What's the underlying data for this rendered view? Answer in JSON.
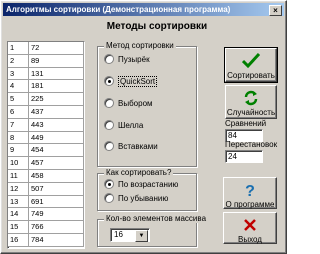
{
  "window": {
    "title": "Алгоритмы сортировки (Демонстрационная программа)",
    "close_glyph": "×"
  },
  "heading": "Методы сортировки",
  "list": {
    "rows": [
      {
        "index": "1",
        "value": "72"
      },
      {
        "index": "2",
        "value": "89"
      },
      {
        "index": "3",
        "value": "131"
      },
      {
        "index": "4",
        "value": "181"
      },
      {
        "index": "5",
        "value": "225"
      },
      {
        "index": "6",
        "value": "437"
      },
      {
        "index": "7",
        "value": "443"
      },
      {
        "index": "8",
        "value": "449"
      },
      {
        "index": "9",
        "value": "454"
      },
      {
        "index": "10",
        "value": "457"
      },
      {
        "index": "11",
        "value": "458"
      },
      {
        "index": "12",
        "value": "507"
      },
      {
        "index": "13",
        "value": "691"
      },
      {
        "index": "14",
        "value": "749"
      },
      {
        "index": "15",
        "value": "766"
      },
      {
        "index": "16",
        "value": "784"
      }
    ]
  },
  "method_group": {
    "label": "Метод сортировки",
    "options": [
      "Пузырёк",
      "QuickSort",
      "Выбором",
      "Шелла",
      "Вставками"
    ],
    "selected_index": 1
  },
  "order_group": {
    "label": "Как сортировать?",
    "options": [
      "По возрастанию",
      "По убыванию"
    ],
    "selected_index": 0
  },
  "count_group": {
    "label": "Кол-во элементов массива",
    "value": "16",
    "arrow": "▼"
  },
  "buttons": {
    "sort": "Сортировать",
    "random": "Случайность",
    "about": "О программе",
    "exit": "Выход"
  },
  "stats": {
    "comparisons_label": "Сравнений",
    "comparisons_value": "84",
    "swaps_label": "Перестановок",
    "swaps_value": "24"
  },
  "colors": {
    "titlebar_start": "#0a246a",
    "face": "#d4d0c8",
    "check_green": "#008000",
    "about_blue": "#1a6fb0",
    "exit_red": "#c00000"
  },
  "icons": {
    "sort": "checkmark-icon",
    "random": "refresh-icon",
    "about": "question-icon",
    "exit": "x-icon"
  }
}
